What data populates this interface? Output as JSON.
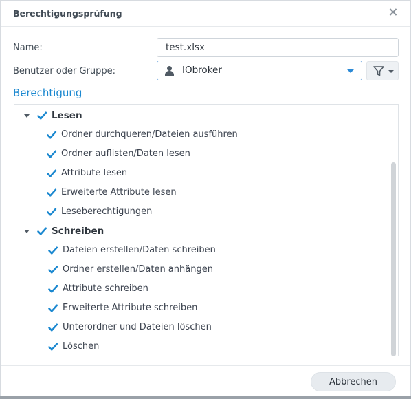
{
  "dialog": {
    "title": "Berechtigungsprüfung",
    "close_icon": "close-icon"
  },
  "form": {
    "name_label": "Name:",
    "name_value": "test.xlsx",
    "user_label": "Benutzer oder Gruppe:",
    "user_value": "IObroker",
    "user_icon": "user-icon",
    "filter_icon": "filter-icon"
  },
  "section_title": "Berechtigung",
  "tree": {
    "groups": [
      {
        "label": "Lesen",
        "checked": true,
        "items": [
          {
            "label": "Ordner durchqueren/Dateien ausführen",
            "checked": true
          },
          {
            "label": "Ordner auflisten/Daten lesen",
            "checked": true
          },
          {
            "label": "Attribute lesen",
            "checked": true
          },
          {
            "label": "Erweiterte Attribute lesen",
            "checked": true
          },
          {
            "label": "Leseberechtigungen",
            "checked": true
          }
        ]
      },
      {
        "label": "Schreiben",
        "checked": true,
        "items": [
          {
            "label": "Dateien erstellen/Daten schreiben",
            "checked": true
          },
          {
            "label": "Ordner erstellen/Daten anhängen",
            "checked": true
          },
          {
            "label": "Attribute schreiben",
            "checked": true
          },
          {
            "label": "Erweiterte Attribute schreiben",
            "checked": true
          },
          {
            "label": "Unterordner und Dateien löschen",
            "checked": true
          },
          {
            "label": "Löschen",
            "checked": true
          }
        ]
      }
    ]
  },
  "footer": {
    "cancel_label": "Abbrechen"
  },
  "colors": {
    "accent": "#1b88d0",
    "checkbox": "#1b88d0"
  }
}
